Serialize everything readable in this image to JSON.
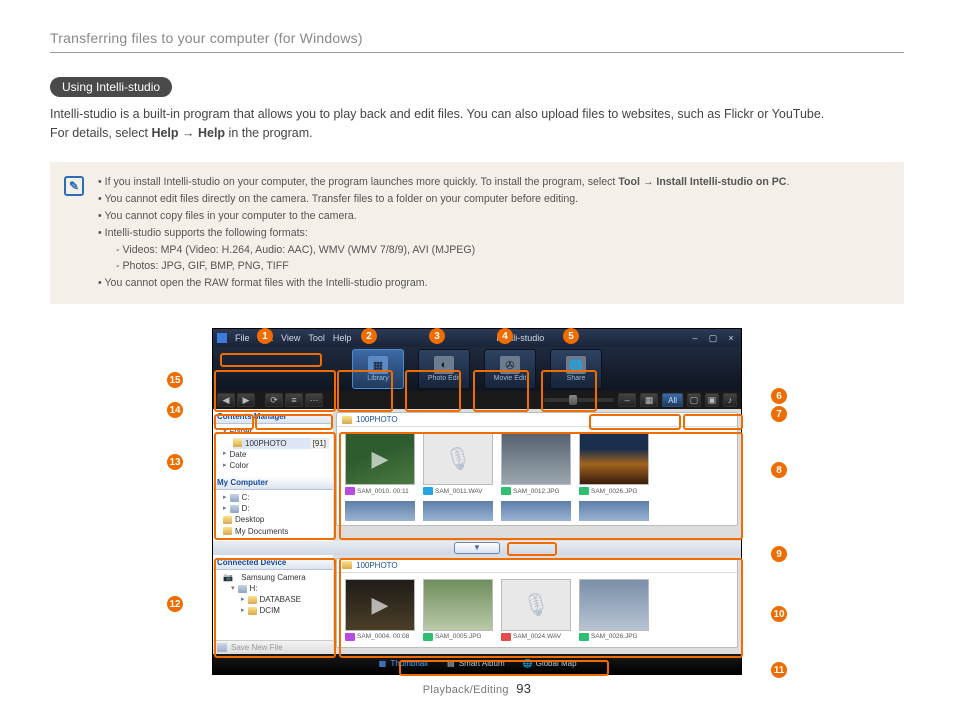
{
  "page": {
    "header": "Transferring files to your computer (for Windows)",
    "section_title": "Using Intelli-studio",
    "intro_1": "Intelli-studio is a built-in program that allows you to play back and edit files. You can also upload files to websites, such as Flickr or YouTube.",
    "intro_2a": "For details, select ",
    "intro_help1": "Help",
    "intro_arrow": " → ",
    "intro_help2": "Help",
    "intro_2b": " in the program.",
    "footer_section": "Playback/Editing",
    "footer_page": "93"
  },
  "notes": {
    "n1a": "If you install Intelli-studio on your computer, the program launches more quickly. To install the program, select ",
    "n1b": "Tool",
    "n1c": " → ",
    "n1d": "Install Intelli-studio on PC",
    "n1e": ".",
    "n2": "You cannot edit files directly on the camera. Transfer files to a folder on your computer before editing.",
    "n3": "You cannot copy files in your computer to the camera.",
    "n4": "Intelli-studio supports the following formats:",
    "n4a": "Videos: MP4 (Video: H.264, Audio: AAC), WMV (WMV 7/8/9), AVI (MJPEG)",
    "n4b": "Photos: JPG, GIF, BMP, PNG, TIFF",
    "n5": "You cannot open the RAW format files with the Intelli-studio program."
  },
  "callouts": {
    "c1": "1",
    "c2": "2",
    "c3": "3",
    "c4": "4",
    "c5": "5",
    "c6": "6",
    "c7": "7",
    "c8": "8",
    "c9": "9",
    "c10": "10",
    "c11": "11",
    "c12": "12",
    "c13": "13",
    "c14": "14",
    "c15": "15"
  },
  "app": {
    "brand": "Intelli-studio",
    "menu": {
      "file": "File",
      "edit": "Edit",
      "view": "View",
      "tool": "Tool",
      "help": "Help"
    },
    "modes": {
      "library": "Library",
      "photo": "Photo Edit",
      "movie": "Movie Edit",
      "share": "Share"
    },
    "filter_all": "All",
    "panels": {
      "contents_manager": "Contents Manager",
      "folder_label": "Folder",
      "folder_100": "100PHOTO",
      "folder_count": "[91]",
      "date": "Date",
      "color": "Color",
      "my_computer": "My Computer",
      "drive_c": "C:",
      "drive_d": "D:",
      "desktop": "Desktop",
      "my_documents": "My Documents",
      "connected_device": "Connected Device",
      "samsung_camera": "Samsung Camera",
      "drive_h": "H:",
      "database": "DATABASE",
      "dcim": "DCIM",
      "save_new": "Save New File"
    },
    "gallery_top": {
      "folder": "100PHOTO",
      "items": [
        {
          "name": "SAM_0010.",
          "meta": "00:11",
          "type": "vid"
        },
        {
          "name": "SAM_0011.WAV",
          "meta": "",
          "type": "aud"
        },
        {
          "name": "SAM_0012.JPG",
          "meta": "",
          "type": "img"
        },
        {
          "name": "SAM_0026.JPG",
          "meta": "",
          "type": "img"
        }
      ]
    },
    "gallery_bottom": {
      "folder": "100PHOTO",
      "items": [
        {
          "name": "SAM_0004.",
          "meta": "00:08",
          "type": "vid"
        },
        {
          "name": "SAM_0005.JPG",
          "meta": "",
          "type": "img"
        },
        {
          "name": "SAM_0024.WAV",
          "meta": "",
          "type": "vid2"
        },
        {
          "name": "SAM_0026.JPG",
          "meta": "",
          "type": "img"
        }
      ]
    },
    "bottom_bar": {
      "thumbnail": "Thumbnail",
      "smart": "Smart Album",
      "map": "Global Map"
    }
  }
}
